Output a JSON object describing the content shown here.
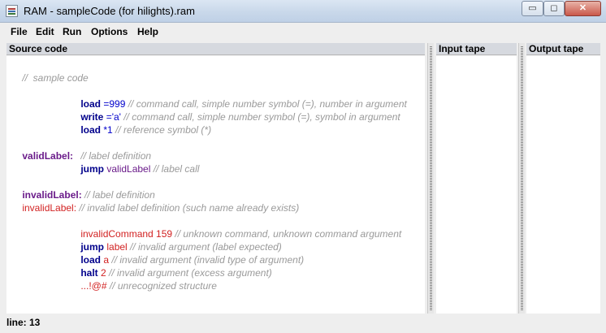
{
  "window": {
    "title": "RAM - sampleCode (for hilights).ram",
    "minimize_glyph": "▭",
    "maximize_glyph": "◻",
    "close_glyph": "✕"
  },
  "menu": {
    "file": "File",
    "edit": "Edit",
    "run": "Run",
    "options": "Options",
    "help": "Help"
  },
  "source_panel": {
    "title": "Source code"
  },
  "input_tape": {
    "title": "Input tape"
  },
  "output_tape": {
    "title": "Output tape"
  },
  "code": {
    "l1": {
      "comment": "//  sample code"
    },
    "l2": {
      "cmd": "load",
      "sym": " =",
      "arg": "999",
      "comment": " // command call, simple number symbol (=), number in argument"
    },
    "l3": {
      "cmd": "write",
      "sym": " =",
      "arg": "'a'",
      "comment": " // command call, simple number symbol (=), symbol in argument"
    },
    "l4": {
      "cmd": "load",
      "sym": " *",
      "arg": "1",
      "comment": " // reference symbol (*)"
    },
    "l5": {
      "label": "validLabel:",
      "comment": "// label definition"
    },
    "l6": {
      "cmd": "jump",
      "arg": " validLabel",
      "comment": " // label call"
    },
    "l7": {
      "label": "invalidLabel:",
      "comment": " // label definition"
    },
    "l8": {
      "label": "invalidLabel:",
      "comment": " // invalid label definition (such name already exists)"
    },
    "l9": {
      "cmd": "invalidCommand",
      "arg": " 159",
      "comment": " // unknown command, unknown command argument"
    },
    "l10": {
      "cmd": "jump",
      "arg": " label",
      "comment": " // invalid argument (label expected)"
    },
    "l11": {
      "cmd": "load",
      "arg": " a",
      "comment": " // invalid argument (invalid type of argument)"
    },
    "l12": {
      "cmd": "halt",
      "arg": " 2",
      "comment": " // invalid argument (excess argument)"
    },
    "l13": {
      "cmd": "...!@#",
      "comment": " // unrecognized structure"
    }
  },
  "status": {
    "line": "line: 13"
  }
}
